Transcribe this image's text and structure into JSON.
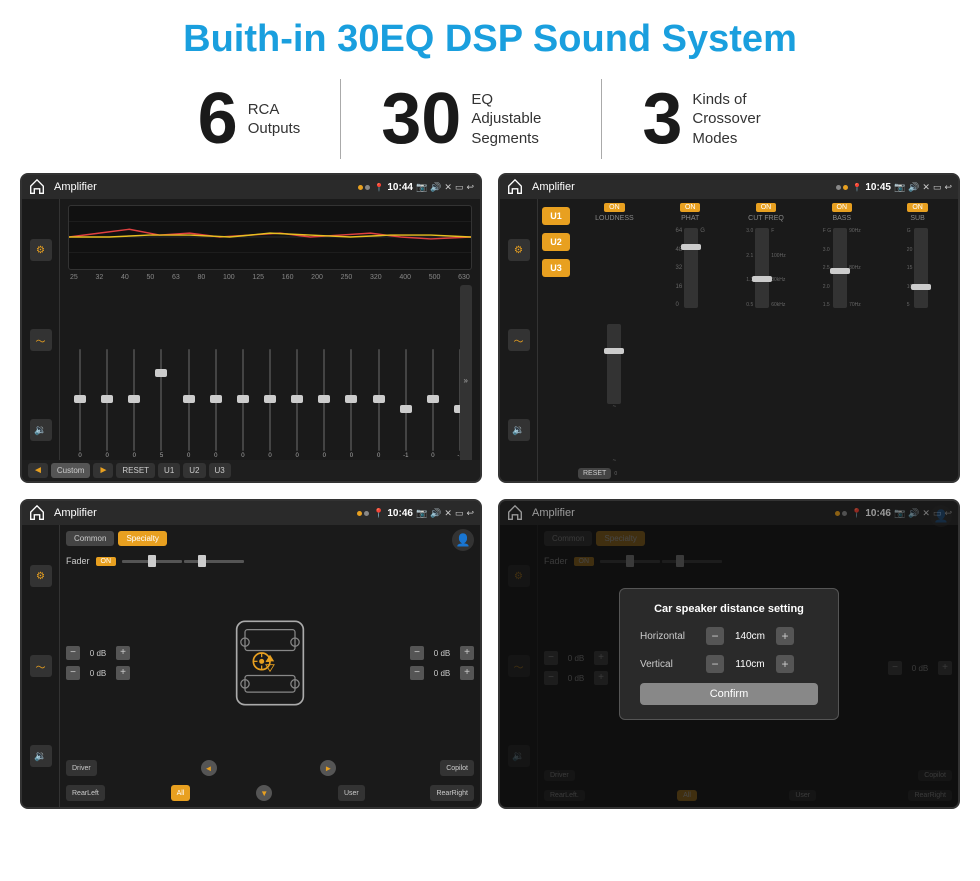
{
  "page": {
    "title": "Buith-in 30EQ DSP Sound System",
    "background": "#ffffff"
  },
  "stats": [
    {
      "number": "6",
      "line1": "RCA",
      "line2": "Outputs"
    },
    {
      "number": "30",
      "line1": "EQ Adjustable",
      "line2": "Segments"
    },
    {
      "number": "3",
      "line1": "Kinds of",
      "line2": "Crossover Modes"
    }
  ],
  "screens": {
    "eq": {
      "title": "Amplifier",
      "time": "10:44",
      "mode": "Custom",
      "eq_labels": [
        "25",
        "32",
        "40",
        "50",
        "63",
        "80",
        "100",
        "125",
        "160",
        "200",
        "250",
        "320",
        "400",
        "500",
        "630"
      ],
      "eq_values": [
        "0",
        "0",
        "0",
        "5",
        "0",
        "0",
        "0",
        "0",
        "0",
        "0",
        "0",
        "0",
        "-1",
        "0",
        "-1"
      ],
      "buttons": [
        "Custom",
        "RESET",
        "U1",
        "U2",
        "U3"
      ]
    },
    "crossover": {
      "title": "Amplifier",
      "time": "10:45",
      "u_buttons": [
        "U1",
        "U2",
        "U3"
      ],
      "controls": [
        {
          "label": "LOUDNESS",
          "on": true
        },
        {
          "label": "PHAT",
          "on": true
        },
        {
          "label": "CUT FREQ",
          "on": true
        },
        {
          "label": "BASS",
          "on": true
        },
        {
          "label": "SUB",
          "on": true
        }
      ],
      "reset_label": "RESET"
    },
    "fader": {
      "title": "Amplifier",
      "time": "10:46",
      "tabs": [
        "Common",
        "Specialty"
      ],
      "active_tab": "Specialty",
      "fader_label": "Fader",
      "fader_on": "ON",
      "zones": {
        "front_left": "0 dB",
        "front_right": "0 dB",
        "rear_left": "0 dB",
        "rear_right": "0 dB"
      },
      "buttons": [
        "Driver",
        "Copilot",
        "RearLeft",
        "All",
        "User",
        "RearRight"
      ]
    },
    "distance": {
      "title": "Amplifier",
      "time": "10:46",
      "tabs": [
        "Common",
        "Specialty"
      ],
      "dialog": {
        "title": "Car speaker distance setting",
        "horizontal_label": "Horizontal",
        "horizontal_value": "140cm",
        "vertical_label": "Vertical",
        "vertical_value": "110cm",
        "confirm_label": "Confirm"
      },
      "zones": {
        "front_left": "0 dB",
        "front_right": "0 dB"
      },
      "buttons": [
        "Driver",
        "Copilot",
        "RearLeft",
        "All",
        "User",
        "RearRight"
      ]
    }
  }
}
